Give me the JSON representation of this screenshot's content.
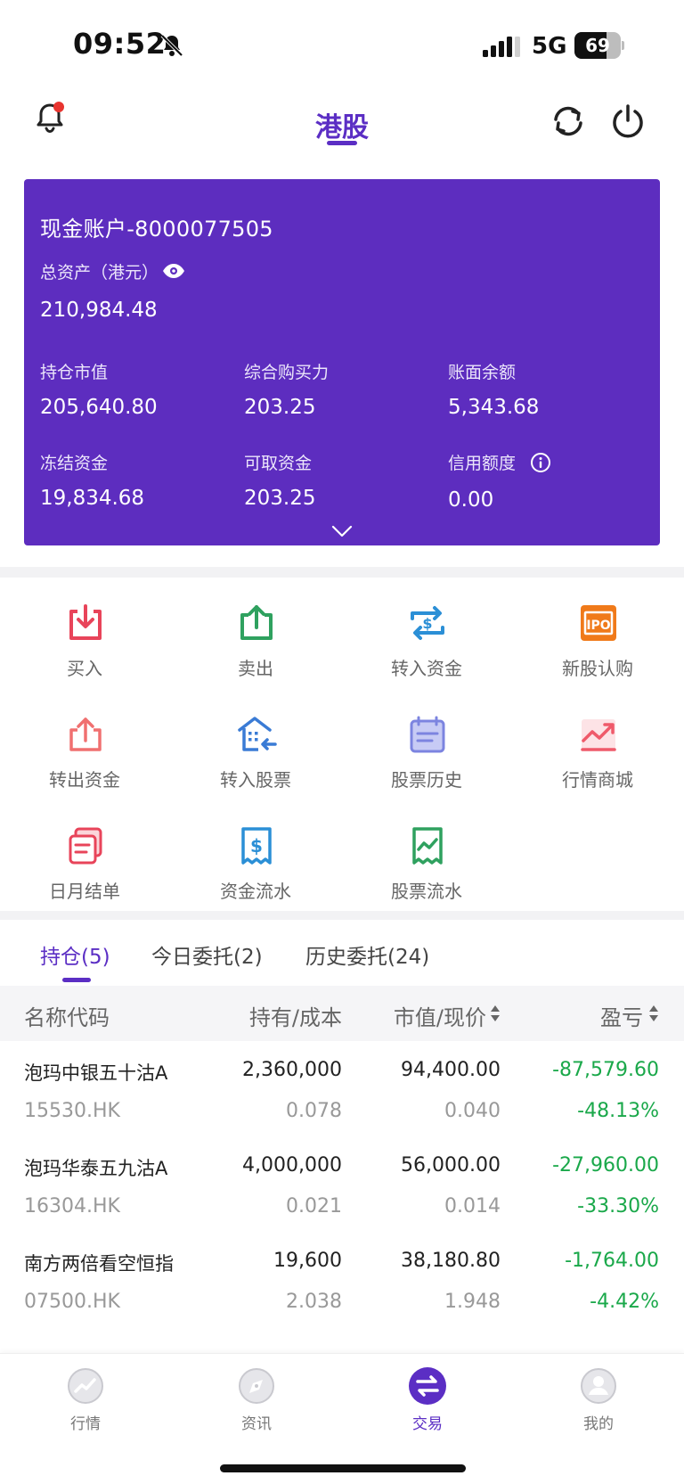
{
  "status_bar": {
    "time": "09:52",
    "network": "5G",
    "battery_level": 69,
    "battery_text": "69"
  },
  "header": {
    "title": "港股",
    "notification_dot": true
  },
  "account": {
    "name": "现金账户-8000077505",
    "total_label": "总资产（港元）",
    "total_value": "210,984.48",
    "metrics": [
      {
        "label": "持仓市值",
        "value": "205,640.80"
      },
      {
        "label": "综合购买力",
        "value": "203.25"
      },
      {
        "label": "账面余额",
        "value": "5,343.68"
      },
      {
        "label": "冻结资金",
        "value": "19,834.68"
      },
      {
        "label": "可取资金",
        "value": "203.25"
      },
      {
        "label": "信用额度",
        "value": "0.00"
      }
    ]
  },
  "functions": [
    {
      "label": "买入",
      "icon": "download-tray-icon",
      "color": "#e8445a"
    },
    {
      "label": "卖出",
      "icon": "upload-tray-icon",
      "color": "#2fa15f"
    },
    {
      "label": "转入资金",
      "icon": "transfer-dollar-icon",
      "color": "#2b8fd6"
    },
    {
      "label": "新股认购",
      "icon": "ipo-icon",
      "color": "#f07a1a"
    },
    {
      "label": "转出资金",
      "icon": "export-icon",
      "color": "#f07070"
    },
    {
      "label": "转入股票",
      "icon": "building-in-icon",
      "color": "#3a7bd5"
    },
    {
      "label": "股票历史",
      "icon": "history-doc-icon",
      "color": "#7c84e0"
    },
    {
      "label": "行情商城",
      "icon": "trend-chart-icon",
      "color": "#ef5a6a"
    },
    {
      "label": "日月结单",
      "icon": "statement-icon",
      "color": "#e8445a"
    },
    {
      "label": "资金流水",
      "icon": "receipt-dollar-icon",
      "color": "#2b8fd6"
    },
    {
      "label": "股票流水",
      "icon": "receipt-chart-icon",
      "color": "#2fa15f"
    }
  ],
  "tabs": [
    {
      "label": "持仓(5)",
      "active": true
    },
    {
      "label": "今日委托(2)",
      "active": false
    },
    {
      "label": "历史委托(24)",
      "active": false
    }
  ],
  "table": {
    "headers": {
      "name": "名称代码",
      "holding": "持有/成本",
      "value": "市值/现价",
      "pnl": "盈亏"
    },
    "rows": [
      {
        "name": "泡玛中银五十沽A",
        "code": "15530.HK",
        "qty": "2,360,000",
        "cost": "0.078",
        "mkt_value": "94,400.00",
        "price": "0.040",
        "pnl": "-87,579.60",
        "pnl_pct": "-48.13%"
      },
      {
        "name": "泡玛华泰五九沽A",
        "code": "16304.HK",
        "qty": "4,000,000",
        "cost": "0.021",
        "mkt_value": "56,000.00",
        "price": "0.014",
        "pnl": "-27,960.00",
        "pnl_pct": "-33.30%"
      },
      {
        "name": "南方两倍看空恒指",
        "code": "07500.HK",
        "qty": "19,600",
        "cost": "2.038",
        "mkt_value": "38,180.80",
        "price": "1.948",
        "pnl": "-1,764.00",
        "pnl_pct": "-4.42%"
      }
    ]
  },
  "bottom_nav": [
    {
      "label": "行情",
      "icon": "chart-circle-icon",
      "active": false
    },
    {
      "label": "资讯",
      "icon": "compass-icon",
      "active": false
    },
    {
      "label": "交易",
      "icon": "exchange-icon",
      "active": true
    },
    {
      "label": "我的",
      "icon": "user-icon",
      "active": false
    }
  ],
  "colors": {
    "accent": "#5b2ec4",
    "card": "#5d2dbf",
    "loss": "#1aa84a",
    "gain": "#f0414b"
  }
}
